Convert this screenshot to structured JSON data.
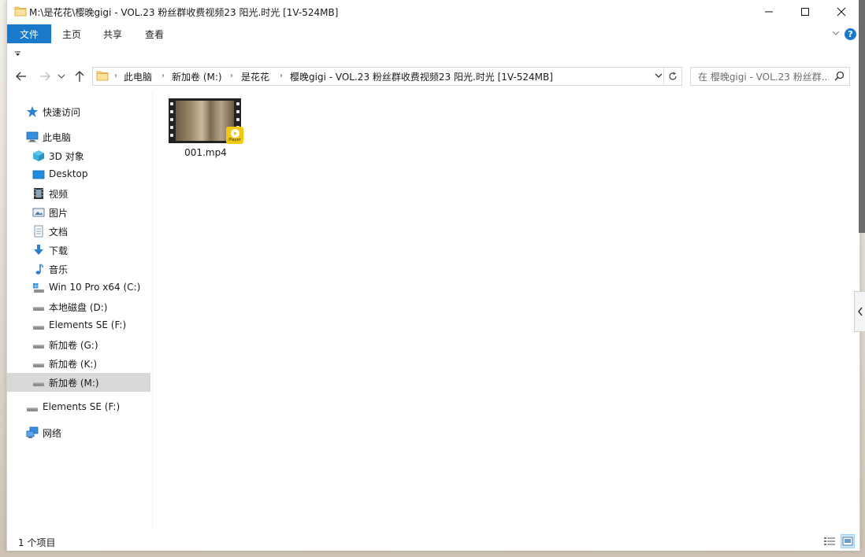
{
  "window": {
    "title": "M:\\是花花\\樱晚gigi - VOL.23 粉丝群收费视频23 阳光.时光 [1V-524MB]"
  },
  "ribbon": {
    "tabs": [
      {
        "label": "文件",
        "active": true
      },
      {
        "label": "主页"
      },
      {
        "label": "共享"
      },
      {
        "label": "查看"
      }
    ],
    "help": "?"
  },
  "address": {
    "breadcrumbs": [
      "此电脑",
      "新加卷 (M:)",
      "是花花",
      "樱晚gigi - VOL.23 粉丝群收费视频23 阳光.时光 [1V-524MB]"
    ]
  },
  "search": {
    "placeholder": "在 樱晚gigi - VOL.23 粉丝群..."
  },
  "sidebar": {
    "items": [
      {
        "label": "快速访问",
        "icon": "star-icon"
      },
      {
        "label": "此电脑",
        "icon": "computer-icon"
      },
      {
        "label": "3D 对象",
        "icon": "cube-3d-icon"
      },
      {
        "label": "Desktop",
        "icon": "desktop-icon"
      },
      {
        "label": "视频",
        "icon": "video-icon"
      },
      {
        "label": "图片",
        "icon": "pictures-icon"
      },
      {
        "label": "文档",
        "icon": "documents-icon"
      },
      {
        "label": "下载",
        "icon": "download-icon"
      },
      {
        "label": "音乐",
        "icon": "music-icon"
      },
      {
        "label": "Win 10 Pro x64 (C:)",
        "icon": "system-drive-icon"
      },
      {
        "label": "本地磁盘 (D:)",
        "icon": "drive-icon"
      },
      {
        "label": "Elements SE (F:)",
        "icon": "drive-icon"
      },
      {
        "label": "新加卷 (G:)",
        "icon": "drive-icon"
      },
      {
        "label": "新加卷 (K:)",
        "icon": "drive-icon"
      },
      {
        "label": "新加卷 (M:)",
        "icon": "drive-icon",
        "selected": true
      },
      {
        "label": "Elements SE (F:)",
        "icon": "drive-icon"
      },
      {
        "label": "网络",
        "icon": "network-icon"
      }
    ]
  },
  "files": [
    {
      "name": "001.mp4",
      "badge": "Player"
    }
  ],
  "status": {
    "item_count": "1 个项目"
  },
  "colors": {
    "accent": "#1979ca",
    "selected_bg": "#d9d9d9",
    "folder_yellow": "#f8d775",
    "player_badge": "#f3c90e"
  }
}
